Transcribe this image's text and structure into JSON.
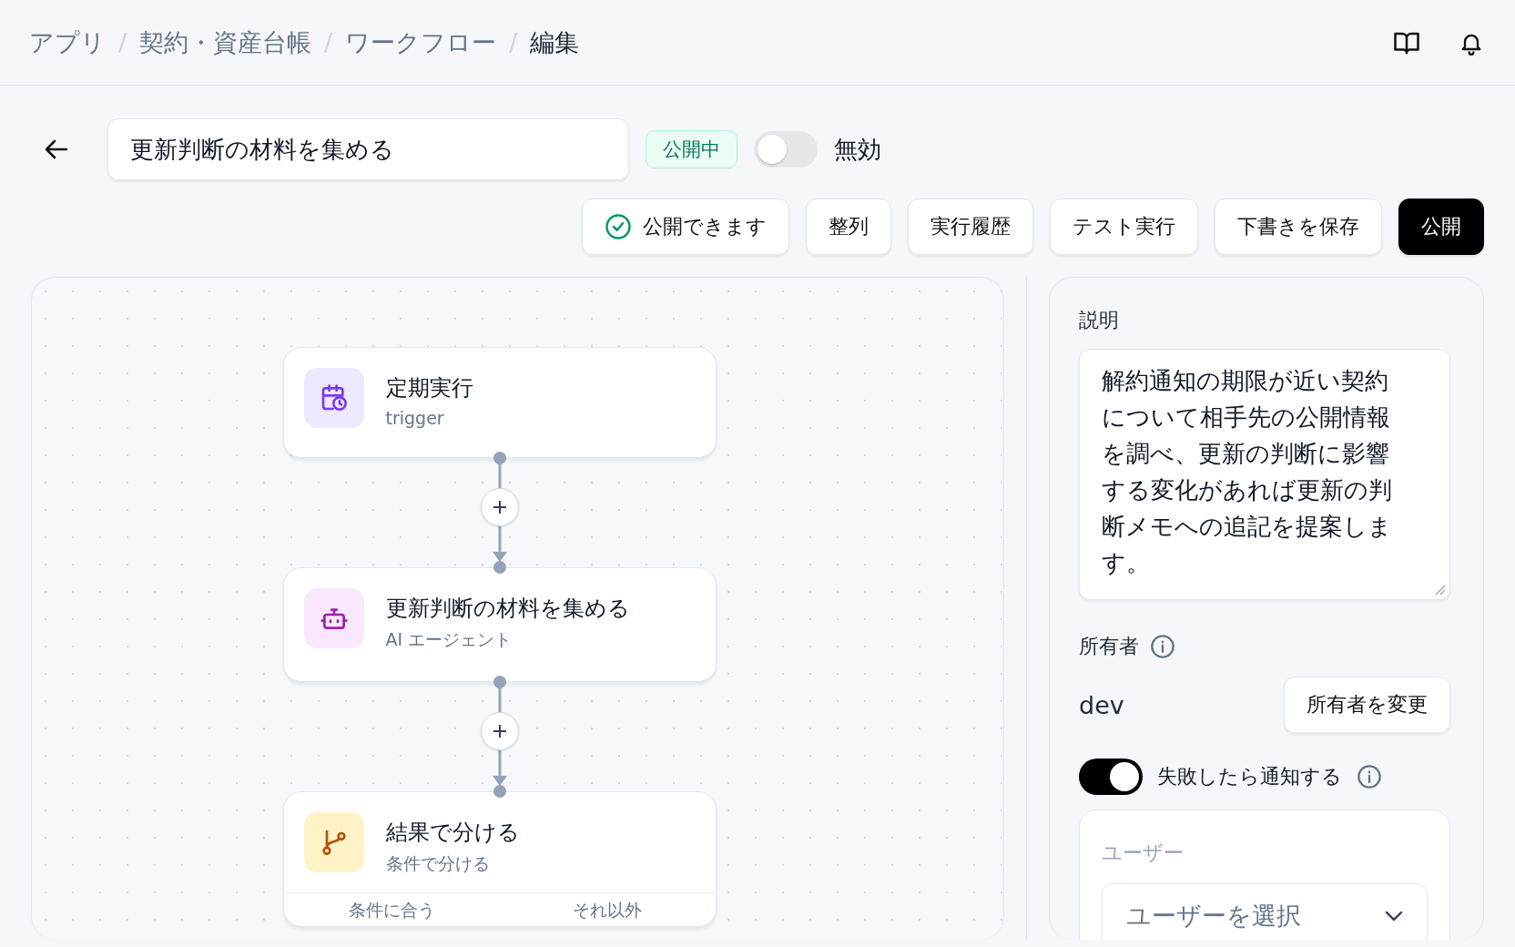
{
  "breadcrumb": [
    {
      "label": "アプリ",
      "current": false
    },
    {
      "separator": "/",
      "label": "契約・資産台帳",
      "current": false
    },
    {
      "separator": "/",
      "label": "ワークフロー",
      "current": false
    },
    {
      "separator": "/",
      "label": "編集",
      "current": true
    }
  ],
  "workflow": {
    "name": "更新判断の材料を集める",
    "status_badge": "公開中",
    "enabled": false,
    "enabled_label": "無効"
  },
  "actions": [
    {
      "label": "公開できます",
      "kind": "check"
    },
    {
      "label": "整列",
      "kind": "plain"
    },
    {
      "label": "実行履歴",
      "kind": "plain"
    },
    {
      "label": "テスト実行",
      "kind": "plain"
    },
    {
      "label": "下書きを保存",
      "kind": "plain"
    },
    {
      "label": "公開",
      "kind": "primary"
    }
  ],
  "nodes": [
    {
      "kind": "trigger",
      "title": "定期実行",
      "subtitle": "trigger"
    },
    {
      "kind": "agent",
      "title": "更新判断の材料を集める",
      "subtitle": "AI エージェント"
    },
    {
      "kind": "branch",
      "title": "結果で分ける",
      "subtitle": "条件で分ける",
      "branches": [
        "条件に合う",
        "それ以外"
      ]
    }
  ],
  "details": {
    "description_label": "説明",
    "description": "解約通知の期限が近い契約について相手先の公開情報を調べ、更新の判断に影響する変化があれば更新の判断メモへの追記を提案します。",
    "owner_label": "所有者",
    "owner": "dev",
    "change_owner": "所有者を変更",
    "notify_on_failure": true,
    "notify_label": "失敗したら通知する",
    "recipient": {
      "label": "ユーザー",
      "placeholder": "ユーザーを選択"
    }
  }
}
